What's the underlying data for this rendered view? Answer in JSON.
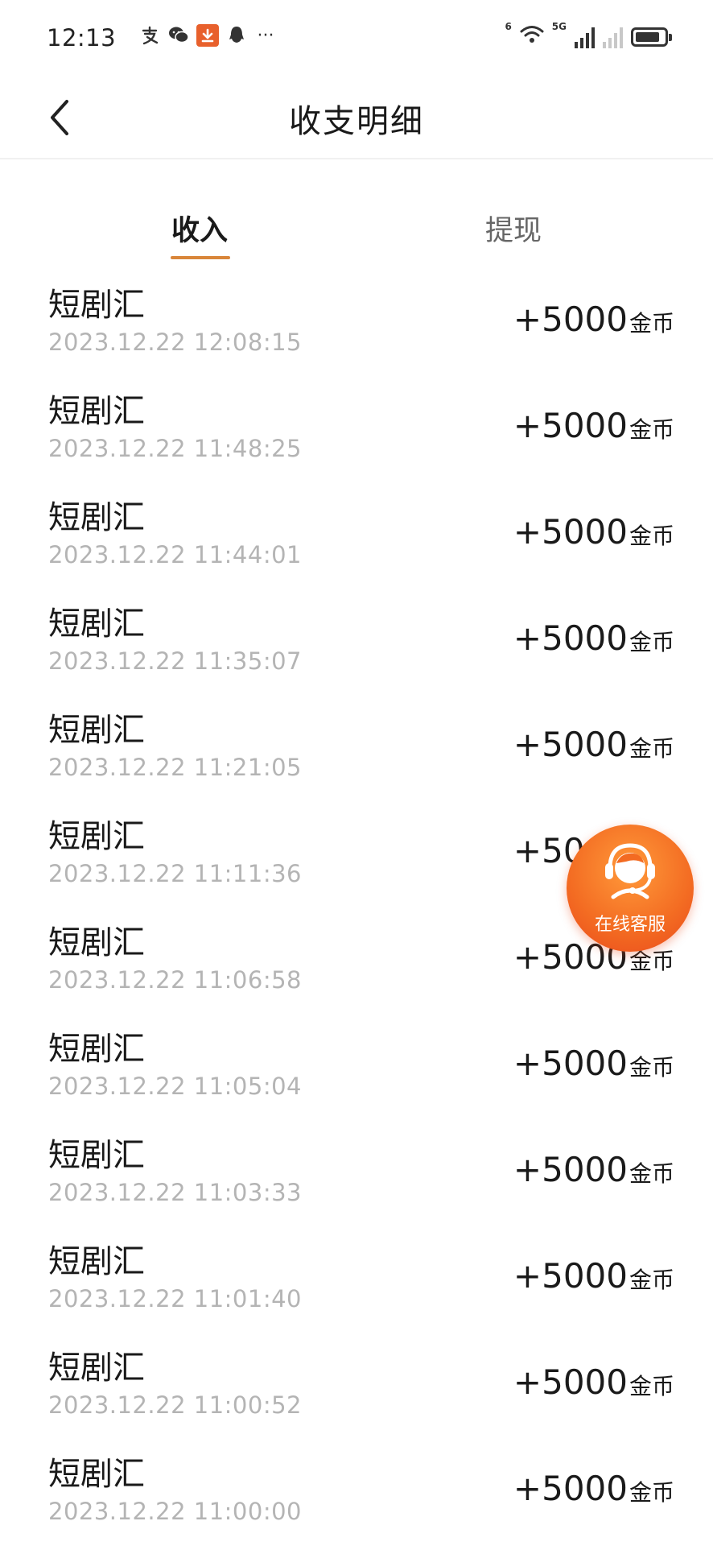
{
  "status_bar": {
    "time": "12:13",
    "left_icons": [
      "alipay-icon",
      "wechat-icon",
      "download-icon",
      "qq-icon",
      "more-dots-icon"
    ],
    "more": "···",
    "net_tag_1": "6",
    "net_tag_2": "5G",
    "battery_level": 0.85
  },
  "header": {
    "title": "收支明细"
  },
  "tabs": [
    {
      "label": "收入",
      "active": true
    },
    {
      "label": "提现",
      "active": false
    }
  ],
  "records": [
    {
      "name": "短剧汇",
      "time": "2023.12.22 12:08:15",
      "amount": "+5000",
      "unit": "金币"
    },
    {
      "name": "短剧汇",
      "time": "2023.12.22 11:48:25",
      "amount": "+5000",
      "unit": "金币"
    },
    {
      "name": "短剧汇",
      "time": "2023.12.22 11:44:01",
      "amount": "+5000",
      "unit": "金币"
    },
    {
      "name": "短剧汇",
      "time": "2023.12.22 11:35:07",
      "amount": "+5000",
      "unit": "金币"
    },
    {
      "name": "短剧汇",
      "time": "2023.12.22 11:21:05",
      "amount": "+5000",
      "unit": "金币"
    },
    {
      "name": "短剧汇",
      "time": "2023.12.22 11:11:36",
      "amount": "+5000",
      "unit": "金币"
    },
    {
      "name": "短剧汇",
      "time": "2023.12.22 11:06:58",
      "amount": "+5000",
      "unit": "金币"
    },
    {
      "name": "短剧汇",
      "time": "2023.12.22 11:05:04",
      "amount": "+5000",
      "unit": "金币"
    },
    {
      "name": "短剧汇",
      "time": "2023.12.22 11:03:33",
      "amount": "+5000",
      "unit": "金币"
    },
    {
      "name": "短剧汇",
      "time": "2023.12.22 11:01:40",
      "amount": "+5000",
      "unit": "金币"
    },
    {
      "name": "短剧汇",
      "time": "2023.12.22 11:00:52",
      "amount": "+5000",
      "unit": "金币"
    },
    {
      "name": "短剧汇",
      "time": "2023.12.22 11:00:00",
      "amount": "+5000",
      "unit": "金币"
    }
  ],
  "service": {
    "label": "在线客服",
    "icon": "headset-agent-icon"
  },
  "colors": {
    "tab_indicator": "#d9863a",
    "service_button": "#f36b22",
    "time_text": "#b4b4b4"
  }
}
